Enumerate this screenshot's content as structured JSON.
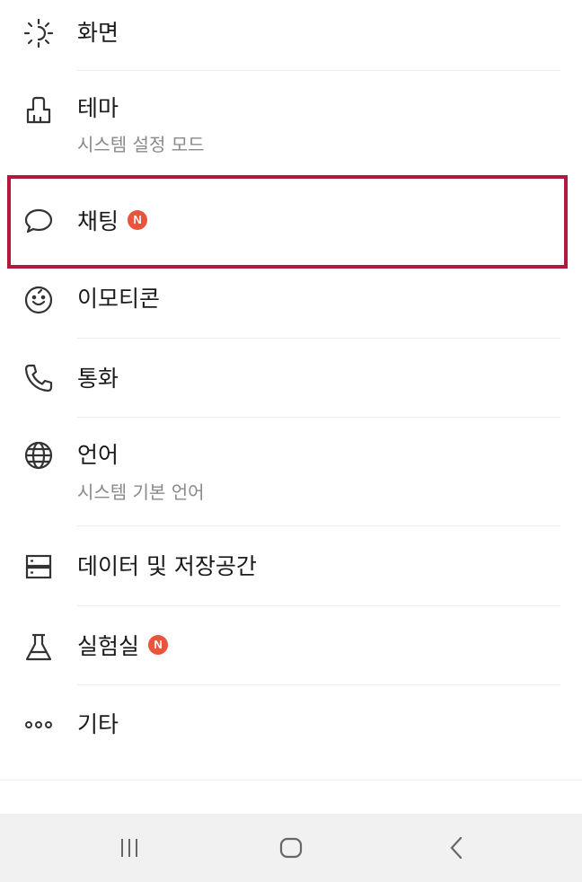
{
  "menu": {
    "items": [
      {
        "label": "화면",
        "icon": "display-brightness-icon"
      },
      {
        "label": "테마",
        "sub": "시스템 설정 모드",
        "icon": "paint-brush-icon"
      },
      {
        "label": "채팅",
        "badge": "N",
        "icon": "speech-bubble-icon"
      },
      {
        "label": "이모티콘",
        "icon": "smiley-icon"
      },
      {
        "label": "통화",
        "icon": "phone-icon"
      },
      {
        "label": "언어",
        "sub": "시스템 기본 언어",
        "icon": "globe-icon"
      },
      {
        "label": "데이터 및 저장공간",
        "icon": "storage-icon"
      },
      {
        "label": "실험실",
        "badge": "N",
        "icon": "flask-icon"
      },
      {
        "label": "기타",
        "icon": "more-dots-icon"
      }
    ]
  },
  "colors": {
    "badge": "#e8553a",
    "highlight_border": "#b5183f",
    "subtext": "#8a8a8a",
    "navbar_bg": "#f1f1f1"
  },
  "navbar": {
    "buttons": [
      "recent-apps-icon",
      "home-icon",
      "back-icon"
    ]
  }
}
